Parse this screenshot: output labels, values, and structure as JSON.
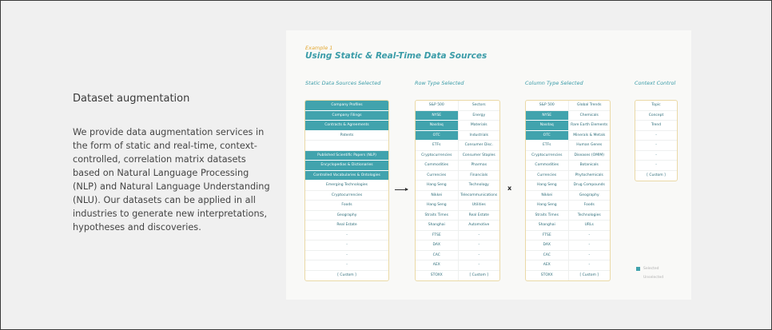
{
  "left": {
    "heading": "Dataset augmentation",
    "body": "We provide data augmentation services in the form of static and real-time, context-controlled, correlation matrix datasets based on Natural Language Processing (NLP) and Natural Language Understanding (NLU). Our datasets can be applied in all industries to generate new interpretations, hypotheses and discoveries."
  },
  "example": {
    "label": "Example 1",
    "title": "Using Static & Real-Time Data Sources"
  },
  "columns": {
    "static_title": "Static Data Sources Selected",
    "row_title": "Row Type Selected",
    "col_title": "Column Type Selected",
    "context_title": "Context Control"
  },
  "static_items": [
    {
      "label": "Company Profiles",
      "sel": true
    },
    {
      "label": "Company Filings",
      "sel": true
    },
    {
      "label": "Contracts & Agreements",
      "sel": true
    },
    {
      "label": "Patents",
      "sel": false
    },
    {
      "label": "",
      "sel": false
    },
    {
      "label": "Published Scientific Papers (NLP)",
      "sel": true
    },
    {
      "label": "Encyclopedias & Dictionaries",
      "sel": true
    },
    {
      "label": "Controlled Vocabularies & Ontologies",
      "sel": true
    },
    {
      "label": "Emerging Technologies",
      "sel": false
    },
    {
      "label": "Cryptocurrencies",
      "sel": false
    },
    {
      "label": "Foods",
      "sel": false
    },
    {
      "label": "Geography",
      "sel": false
    },
    {
      "label": "Real Estate",
      "sel": false
    },
    {
      "label": "-",
      "sel": false
    },
    {
      "label": "-",
      "sel": false
    },
    {
      "label": "-",
      "sel": false
    },
    {
      "label": "-",
      "sel": false
    },
    {
      "label": "[ Custom ]",
      "sel": false
    }
  ],
  "row_left": [
    {
      "label": "S&P 500",
      "sel": false
    },
    {
      "label": "NYSE",
      "sel": true
    },
    {
      "label": "Nasdaq",
      "sel": true
    },
    {
      "label": "OTC",
      "sel": true
    },
    {
      "label": "ETFs",
      "sel": false
    },
    {
      "label": "Cryptocurrencies",
      "sel": false
    },
    {
      "label": "Commodities",
      "sel": false
    },
    {
      "label": "Currencies",
      "sel": false
    },
    {
      "label": "Hang Seng",
      "sel": false
    },
    {
      "label": "Nikkei",
      "sel": false
    },
    {
      "label": "Hang Seng",
      "sel": false
    },
    {
      "label": "Straits Times",
      "sel": false
    },
    {
      "label": "Shanghai",
      "sel": false
    },
    {
      "label": "FTSE",
      "sel": false
    },
    {
      "label": "DAX",
      "sel": false
    },
    {
      "label": "CAC",
      "sel": false
    },
    {
      "label": "AEX",
      "sel": false
    },
    {
      "label": "STOXX",
      "sel": false
    }
  ],
  "row_right": [
    {
      "label": "Sectors",
      "sel": false
    },
    {
      "label": "Energy",
      "sel": false
    },
    {
      "label": "Materials",
      "sel": false
    },
    {
      "label": "Industrials",
      "sel": false
    },
    {
      "label": "Consumer Disc.",
      "sel": false
    },
    {
      "label": "Consumer Staples",
      "sel": false
    },
    {
      "label": "Pharmas",
      "sel": false
    },
    {
      "label": "Financials",
      "sel": false
    },
    {
      "label": "Technology",
      "sel": false
    },
    {
      "label": "Telecommunications",
      "sel": false
    },
    {
      "label": "Utilities",
      "sel": false
    },
    {
      "label": "Real Estate",
      "sel": false
    },
    {
      "label": "Automotive",
      "sel": false
    },
    {
      "label": "-",
      "sel": false
    },
    {
      "label": "-",
      "sel": false
    },
    {
      "label": "-",
      "sel": false
    },
    {
      "label": "-",
      "sel": false
    },
    {
      "label": "[ Custom ]",
      "sel": false
    }
  ],
  "col_left": [
    {
      "label": "S&P 500",
      "sel": false
    },
    {
      "label": "NYSE",
      "sel": true
    },
    {
      "label": "Nasdaq",
      "sel": true
    },
    {
      "label": "OTC",
      "sel": true
    },
    {
      "label": "ETFs",
      "sel": false
    },
    {
      "label": "Cryptocurrencies",
      "sel": false
    },
    {
      "label": "Commodities",
      "sel": false
    },
    {
      "label": "Currencies",
      "sel": false
    },
    {
      "label": "Hang Seng",
      "sel": false
    },
    {
      "label": "Nikkei",
      "sel": false
    },
    {
      "label": "Hang Seng",
      "sel": false
    },
    {
      "label": "Straits Times",
      "sel": false
    },
    {
      "label": "Shanghai",
      "sel": false
    },
    {
      "label": "FTSE",
      "sel": false
    },
    {
      "label": "DAX",
      "sel": false
    },
    {
      "label": "CAC",
      "sel": false
    },
    {
      "label": "AEX",
      "sel": false
    },
    {
      "label": "STOXX",
      "sel": false
    }
  ],
  "col_right": [
    {
      "label": "Global Trends",
      "sel": false
    },
    {
      "label": "Chemicals",
      "sel": false
    },
    {
      "label": "Rare Earth Elements",
      "sel": false
    },
    {
      "label": "Minerals & Metals",
      "sel": false
    },
    {
      "label": "Human Genes",
      "sel": false
    },
    {
      "label": "Diseases (OMIM)",
      "sel": false
    },
    {
      "label": "Botanicals",
      "sel": false
    },
    {
      "label": "Phytochemicals",
      "sel": false
    },
    {
      "label": "Drug Compounds",
      "sel": false
    },
    {
      "label": "Geography",
      "sel": false
    },
    {
      "label": "Foods",
      "sel": false
    },
    {
      "label": "Technologies",
      "sel": false
    },
    {
      "label": "URLs",
      "sel": false
    },
    {
      "label": "-",
      "sel": false
    },
    {
      "label": "-",
      "sel": false
    },
    {
      "label": "-",
      "sel": false
    },
    {
      "label": "-",
      "sel": false
    },
    {
      "label": "[ Custom ]",
      "sel": false
    }
  ],
  "context_items": [
    {
      "label": "Topic",
      "sel": false
    },
    {
      "label": "Concept",
      "sel": false
    },
    {
      "label": "Trend",
      "sel": false
    },
    {
      "label": "-",
      "sel": false
    },
    {
      "label": "-",
      "sel": false
    },
    {
      "label": "-",
      "sel": false
    },
    {
      "label": "-",
      "sel": false
    },
    {
      "label": "[ Custom ]",
      "sel": false
    }
  ],
  "operator": "x",
  "legend": {
    "selected": "Selected",
    "unselected": "Unselected"
  },
  "colors": {
    "accent": "#41a3ad",
    "title": "#3a9ca8",
    "example_label": "#e3a72f"
  }
}
